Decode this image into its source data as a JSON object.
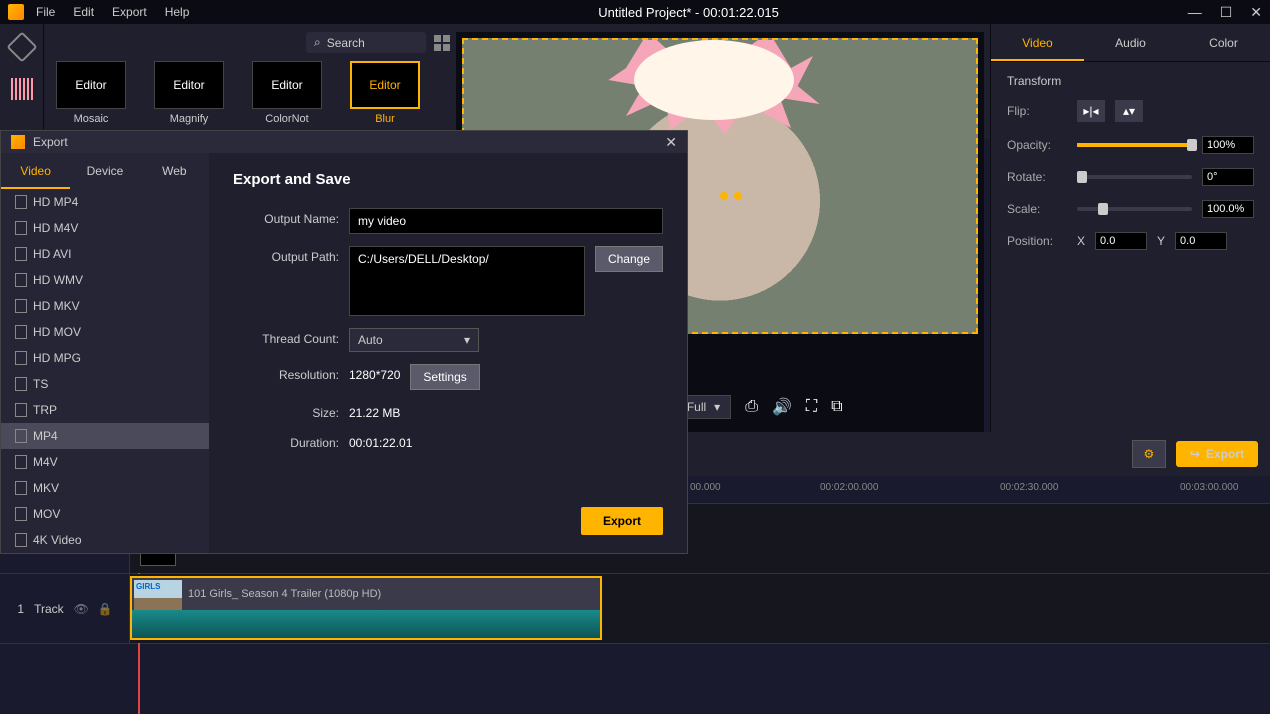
{
  "titlebar": {
    "menu": [
      "File",
      "Edit",
      "Export",
      "Help"
    ],
    "title": "Untitled Project* - 00:01:22.015"
  },
  "search": {
    "placeholder": "Search"
  },
  "editors": [
    {
      "label": "Editor",
      "sub": "Mosaic"
    },
    {
      "label": "Editor",
      "sub": "Magnify"
    },
    {
      "label": "Editor",
      "sub": "ColorNot"
    },
    {
      "label": "Editor",
      "sub": "Blur",
      "active": true
    }
  ],
  "props": {
    "tabs": [
      "Video",
      "Audio",
      "Color"
    ],
    "active": "Video",
    "section": "Transform",
    "flip_label": "Flip:",
    "opacity_label": "Opacity:",
    "opacity_val": "100%",
    "rotate_label": "Rotate:",
    "rotate_val": "0°",
    "scale_label": "Scale:",
    "scale_val": "100.0%",
    "position_label": "Position:",
    "pos_x_label": "X",
    "pos_x": "0.0",
    "pos_y_label": "Y",
    "pos_y": "0.0"
  },
  "player": {
    "full": "Full"
  },
  "timeline": {
    "export_btn": "Export",
    "ticks": [
      "00.000",
      "00:02:00.000",
      "00:02:30.000",
      "00:03:00.000"
    ],
    "track_label": "Track",
    "clip2_thumb": "GIRLS",
    "clip2_label": "101 Girls_ Season 4 Trailer (1080p HD)"
  },
  "dialog": {
    "title": "Export",
    "tabs": [
      "Video",
      "Device",
      "Web"
    ],
    "active_tab": "Video",
    "formats": [
      "HD MP4",
      "HD M4V",
      "HD AVI",
      "HD WMV",
      "HD MKV",
      "HD MOV",
      "HD MPG",
      "TS",
      "TRP",
      "MP4",
      "M4V",
      "MKV",
      "MOV",
      "4K Video"
    ],
    "selected_fmt": "MP4",
    "heading": "Export and Save",
    "output_name_label": "Output Name:",
    "output_name": "my video",
    "output_path_label": "Output Path:",
    "output_path": "C:/Users/DELL/Desktop/",
    "change_btn": "Change",
    "thread_label": "Thread Count:",
    "thread_val": "Auto",
    "resolution_label": "Resolution:",
    "resolution_val": "1280*720",
    "settings_btn": "Settings",
    "size_label": "Size:",
    "size_val": "21.22 MB",
    "duration_label": "Duration:",
    "duration_val": "00:01:22.01",
    "export_btn": "Export"
  }
}
